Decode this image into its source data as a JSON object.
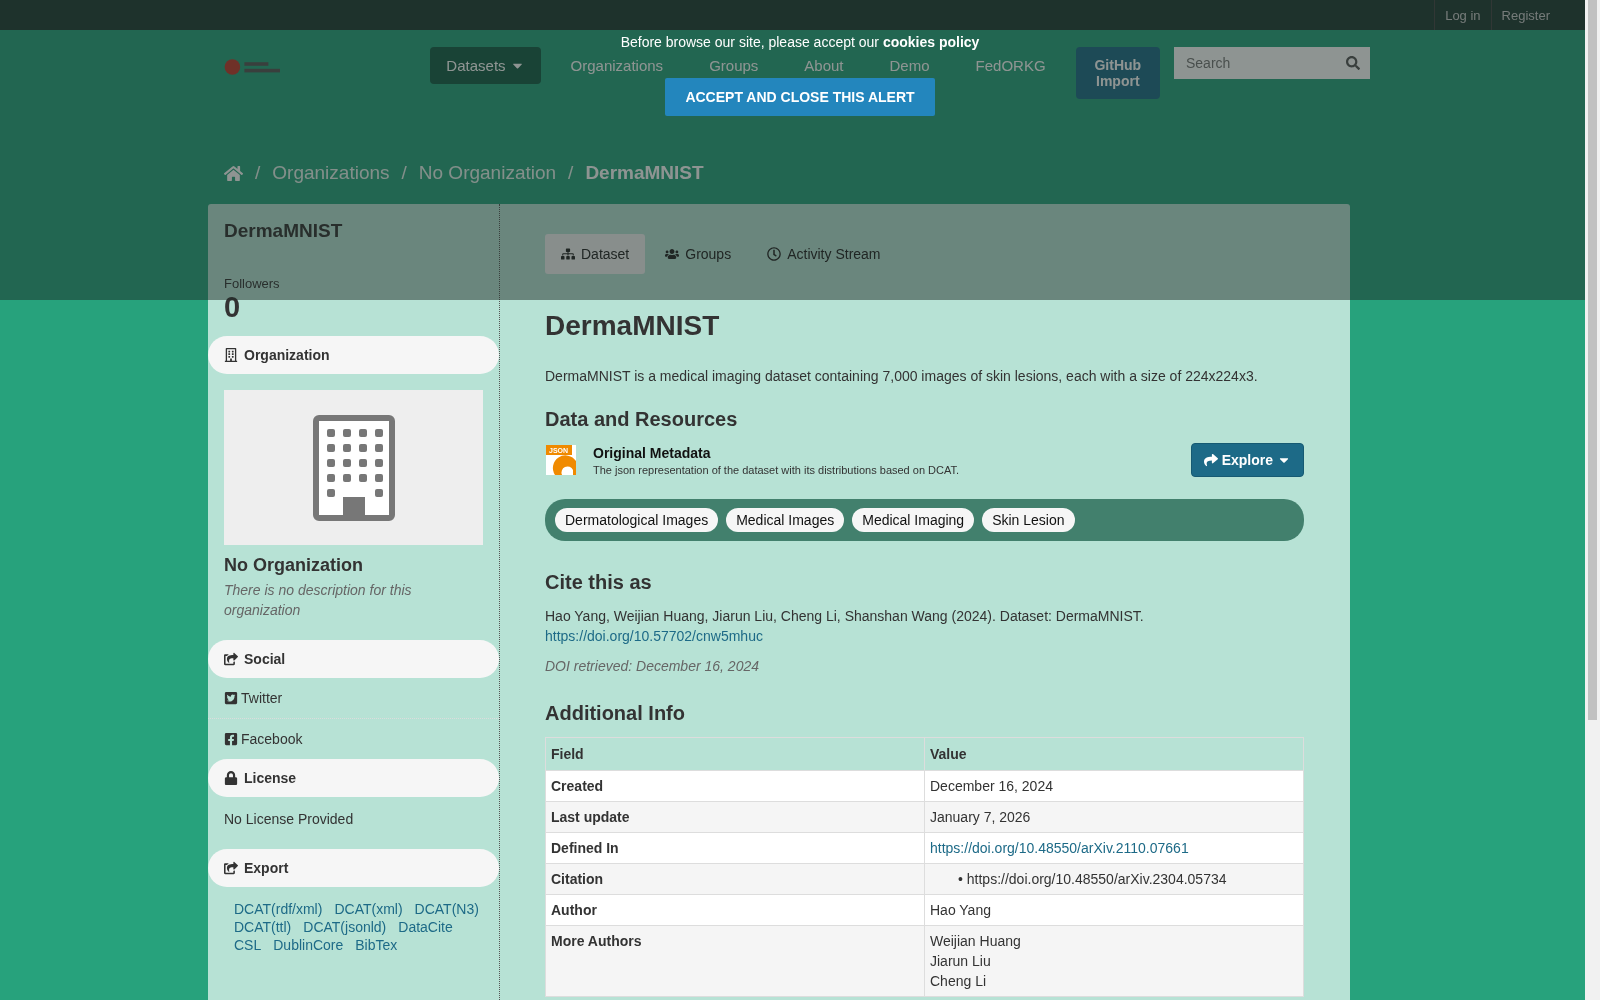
{
  "account_links": [
    "Log in",
    "Register"
  ],
  "nav": [
    {
      "label": "Datasets",
      "selected": true,
      "kind": "dropdown"
    },
    {
      "label": "Organizations",
      "selected": false,
      "kind": "link"
    },
    {
      "label": "Groups",
      "selected": false,
      "kind": "link"
    },
    {
      "label": "About",
      "selected": false,
      "kind": "link"
    },
    {
      "label": "Demo",
      "selected": false,
      "kind": "link"
    },
    {
      "label": "FedORKG",
      "selected": false,
      "kind": "link"
    },
    {
      "label": "GitHub Import",
      "selected": false,
      "kind": "button"
    }
  ],
  "search": {
    "placeholder": "Search"
  },
  "cookie_alert": {
    "text": "Before browse our site, please accept our **cookies policy**",
    "button": "ACCEPT AND CLOSE THIS ALERT"
  },
  "breadcrumbs": [
    "Organizations",
    "No Organization",
    "DermaMNIST"
  ],
  "breadcrumb_separator": "/",
  "bullet": "•",
  "sidebar": {
    "title": "DermaMNIST",
    "followers_label": "Followers",
    "followers": "0",
    "organization": {
      "heading": "Organization",
      "name": "No Organization",
      "description": "There is no description for this organization"
    },
    "social": {
      "heading": "Social",
      "links": [
        {
          "label": "Twitter",
          "kind": "twitter"
        },
        {
          "label": "Facebook",
          "kind": "facebook"
        }
      ]
    },
    "license": {
      "heading": "License",
      "text": "No License Provided"
    },
    "export": {
      "heading": "Export",
      "links": [
        "DCAT(rdf/xml)",
        "DCAT(xml)",
        "DCAT(N3)",
        "DCAT(ttl)",
        "DCAT(jsonld)",
        "DataCite",
        "CSL",
        "DublinCore",
        "BibTex"
      ]
    }
  },
  "tabs": [
    {
      "label": "Dataset",
      "selected": true,
      "kind": "dataset"
    },
    {
      "label": "Groups",
      "selected": false,
      "kind": "groups"
    },
    {
      "label": "Activity Stream",
      "selected": false,
      "kind": "activity"
    }
  ],
  "dataset": {
    "title": "DermaMNIST",
    "description": "DermaMNIST is a medical imaging dataset containing 7,000 images of skin lesions, each with a size of 224x224x3.",
    "resources_heading": "Data and Resources",
    "resources": [
      {
        "format": "JSON",
        "title": "Original Metadata",
        "description": "The json representation of the dataset with its distributions based on DCAT.",
        "button": "Explore"
      }
    ],
    "tags": [
      "Dermatological Images",
      "Medical Images",
      "Medical Imaging",
      "Skin Lesion"
    ],
    "cite_heading": "Cite this as",
    "citation": "Hao Yang, Weijian Huang, Jiarun Liu, Cheng Li, Shanshan Wang (2024). Dataset: DermaMNIST.",
    "citation_link": "https://doi.org/10.57702/cnw5mhuc",
    "doi_retrieved": "DOI retrieved: December 16, 2024",
    "info_heading": "Additional Info",
    "info_columns": [
      "Field",
      "Value"
    ],
    "info_rows": [
      {
        "field": "Created",
        "kind": "text",
        "values": [
          "December 16, 2024"
        ]
      },
      {
        "field": "Last update",
        "kind": "text",
        "values": [
          "January 7, 2026"
        ]
      },
      {
        "field": "Defined In",
        "kind": "link",
        "values": [
          "https://doi.org/10.48550/arXiv.2110.07661"
        ]
      },
      {
        "field": "Citation",
        "kind": "bullets",
        "values": [
          "https://doi.org/10.48550/arXiv.2304.05734"
        ]
      },
      {
        "field": "Author",
        "kind": "text",
        "values": [
          "Hao Yang"
        ]
      },
      {
        "field": "More Authors",
        "kind": "lines",
        "values": [
          "Weijian Huang",
          "Jiarun Liu",
          "Cheng Li"
        ]
      }
    ]
  }
}
